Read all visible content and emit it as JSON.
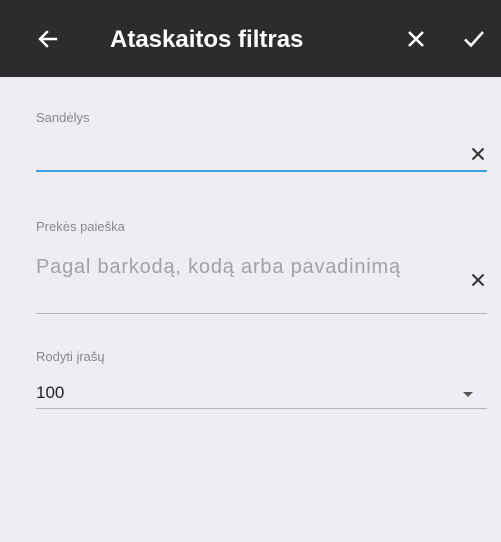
{
  "toolbar": {
    "title": "Ataskaitos filtras",
    "back_icon": "arrow-left-icon",
    "close_icon": "close-icon",
    "confirm_icon": "check-icon",
    "background": "#2d2b2e"
  },
  "warehouse": {
    "label": "Sandėlys",
    "value": "",
    "clear_icon": "close-icon",
    "accent": "#3aa0e0"
  },
  "product_search": {
    "label": "Prekės paieška",
    "placeholder": "Pagal barkodą, kodą arba pavadinimą",
    "value": "",
    "clear_icon": "close-icon"
  },
  "records": {
    "label": "Rodyti įrašų",
    "selected": "100",
    "dropdown_icon": "triangle-down-icon"
  }
}
